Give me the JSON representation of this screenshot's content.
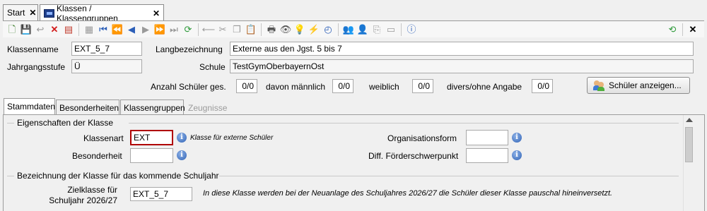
{
  "tabs": [
    {
      "label": "Start"
    },
    {
      "label": "Klassen / Klassengruppen"
    }
  ],
  "close_glyph": "✕",
  "toolbar": {
    "icons": [
      "new-icon",
      "save-icon",
      "undo-icon",
      "delete-icon",
      "cancel-edit-icon",
      "list-icon",
      "first-record-icon",
      "prev-page-icon",
      "prev-record-icon",
      "next-record-icon",
      "next-page-icon",
      "last-record-icon",
      "refresh-icon",
      "arrow-left-icon",
      "cut-icon",
      "copy-icon",
      "paste-icon",
      "print-icon",
      "preview-icon",
      "bulb-icon",
      "wand-icon",
      "clock-icon",
      "group-icon",
      "users-icon",
      "export-icon",
      "chat-icon",
      "help-icon",
      "switch-window-icon",
      "close-window-icon"
    ]
  },
  "header": {
    "klassenname_label": "Klassenname",
    "klassenname_value": "EXT_5_7",
    "langbezeichnung_label": "Langbezeichnung",
    "langbezeichnung_value": "Externe aus den Jgst. 5 bis 7",
    "jahrgangsstufe_label": "Jahrgangsstufe",
    "jahrgangsstufe_value": "Ü",
    "schule_label": "Schule",
    "schule_value": "TestGymOberbayernOst",
    "anzahl_label": "Anzahl Schüler ges.",
    "anzahl_value": "0/0",
    "maennlich_label": "davon männlich",
    "maennlich_value": "0/0",
    "weiblich_label": "weiblich",
    "weiblich_value": "0/0",
    "divers_label": "divers/ohne Angabe",
    "divers_value": "0/0",
    "schueler_button": "Schüler anzeigen..."
  },
  "inner_tabs": [
    {
      "label": "Stammdaten"
    },
    {
      "label": "Besonderheiten"
    },
    {
      "label": "Klassengruppen"
    },
    {
      "label": "Zeugnisse"
    }
  ],
  "eigenschaften": {
    "title": "Eigenschaften der Klasse",
    "klassenart_label": "Klassenart",
    "klassenart_value": "EXT",
    "klassenart_hint": "Klasse für externe Schüler",
    "besonderheit_label": "Besonderheit",
    "besonderheit_value": "",
    "organisationsform_label": "Organisationsform",
    "organisationsform_value": "",
    "foerder_label": "Diff. Förderschwerpunkt",
    "foerder_value": ""
  },
  "kommendes": {
    "title": "Bezeichnung der Klasse für das kommende Schuljahr",
    "zielklasse_label_1": "Zielklasse für",
    "zielklasse_label_2": "Schuljahr 2026/27",
    "zielklasse_value": "EXT_5_7",
    "zielklasse_hint": "In diese Klasse werden bei der Neuanlage des Schuljahres 2026/27 die Schüler dieser Klasse pauschal hineinversetzt."
  },
  "colors": {
    "highlight_border": "#b00000",
    "accent": "#2f62b5"
  }
}
